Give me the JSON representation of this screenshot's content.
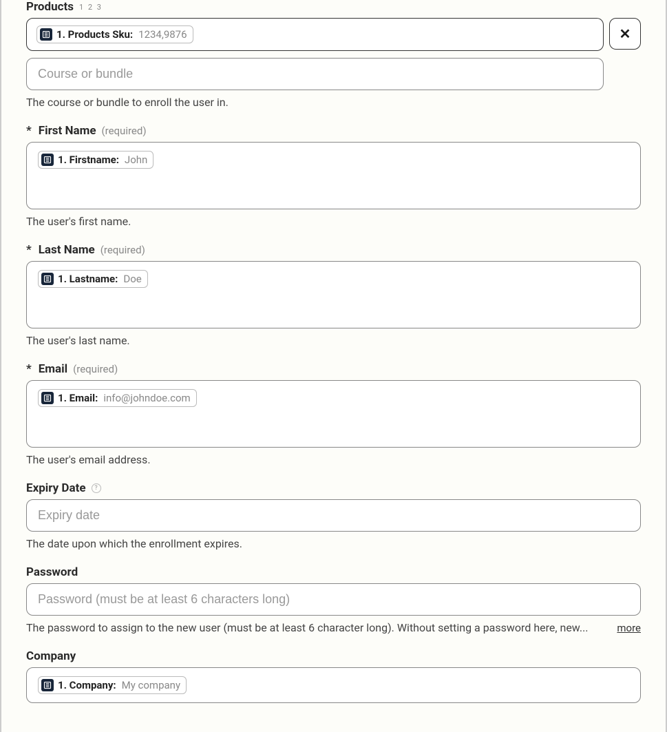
{
  "products": {
    "label": "Products",
    "badge_text": "1 2 3",
    "chip_label": "1. Products Sku:",
    "chip_value": "1234,9876",
    "clear_symbol": "✕",
    "course_placeholder": "Course or bundle",
    "help": "The course or bundle to enroll the user in."
  },
  "first_name": {
    "asterisk": "*",
    "label": "First Name",
    "required": "(required)",
    "chip_label": "1. Firstname:",
    "chip_value": "John",
    "help": "The user's first name."
  },
  "last_name": {
    "asterisk": "*",
    "label": "Last Name",
    "required": "(required)",
    "chip_label": "1. Lastname:",
    "chip_value": "Doe",
    "help": "The user's last name."
  },
  "email": {
    "asterisk": "*",
    "label": "Email",
    "required": "(required)",
    "chip_label": "1. Email:",
    "chip_value": "info@johndoe.com",
    "help": "The user's email address."
  },
  "expiry": {
    "label": "Expiry Date",
    "placeholder": "Expiry date",
    "help": "The date upon which the enrollment expires."
  },
  "password": {
    "label": "Password",
    "placeholder": "Password (must be at least 6 characters long)",
    "help": "The password to assign to the new user (must be at least 6 character long). Without setting a password here, new...",
    "more": "more"
  },
  "company": {
    "label": "Company",
    "chip_label": "1. Company:",
    "chip_value": "My company"
  }
}
